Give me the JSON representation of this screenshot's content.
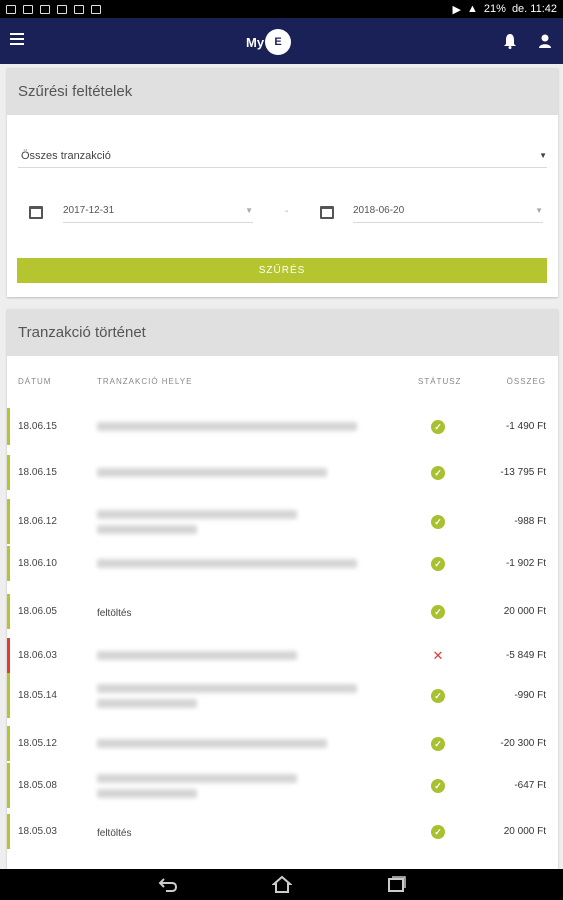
{
  "status_bar": {
    "battery": "21%",
    "time": "de. 11:42"
  },
  "app": {
    "logo_prefix": "My",
    "logo_mark": "Edenred"
  },
  "filter": {
    "title": "Szűrési feltételek",
    "transaction_type": "Összes tranzakció",
    "date_from": "2017-12-31",
    "date_to": "2018-06-20",
    "separator": "-",
    "button": "SZŰRÉS"
  },
  "history": {
    "title": "Tranzakció történet",
    "columns": {
      "date": "DÁTUM",
      "place": "TRANZAKCIÓ HELYE",
      "status": "STÁTUSZ",
      "amount": "ÖSSZEG"
    },
    "rows": [
      {
        "date": "18.06.15",
        "place": "",
        "status": "ok",
        "amount": "-1 490 Ft"
      },
      {
        "date": "18.06.15",
        "place": "",
        "status": "ok",
        "amount": "-13 795 Ft"
      },
      {
        "date": "18.06.12",
        "place": "",
        "status": "ok",
        "amount": "-988 Ft"
      },
      {
        "date": "18.06.10",
        "place": "",
        "status": "ok",
        "amount": "-1 902 Ft"
      },
      {
        "date": "18.06.05",
        "place": "feltöltés",
        "status": "ok",
        "amount": "20 000 Ft"
      },
      {
        "date": "18.06.03",
        "place": "",
        "status": "failed",
        "amount": "-5 849 Ft"
      },
      {
        "date": "18.05.14",
        "place": "",
        "status": "ok",
        "amount": "-990 Ft"
      },
      {
        "date": "18.05.12",
        "place": "",
        "status": "ok",
        "amount": "-20 300 Ft"
      },
      {
        "date": "18.05.08",
        "place": "",
        "status": "ok",
        "amount": "-647 Ft"
      },
      {
        "date": "18.05.03",
        "place": "feltöltés",
        "status": "ok",
        "amount": "20 000 Ft"
      }
    ]
  },
  "colors": {
    "app_bar": "#1a2157",
    "accent": "#b5c530",
    "ok": "#a8c130",
    "error": "#e53935"
  }
}
